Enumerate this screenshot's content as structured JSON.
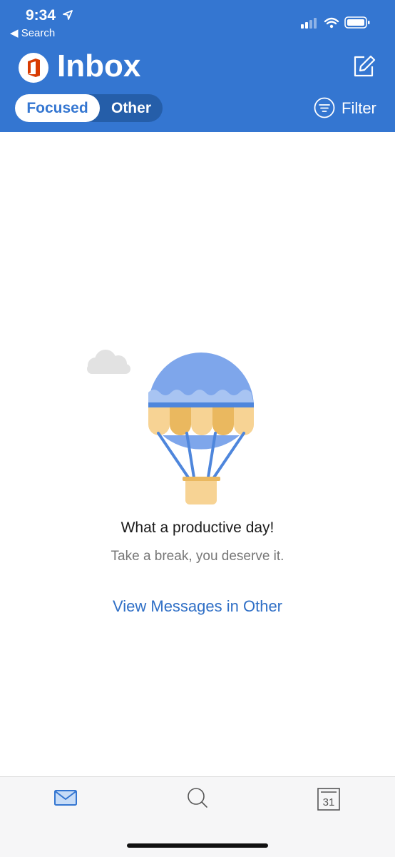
{
  "status_bar": {
    "time": "9:34",
    "back_label": "◀ Search"
  },
  "header": {
    "title": "Inbox",
    "compose_icon": "compose-icon",
    "brand_color": "#3476D1"
  },
  "segments": {
    "focused": "Focused",
    "other": "Other",
    "selected": "Focused"
  },
  "filter": {
    "label": "Filter",
    "icon": "filter-icon"
  },
  "empty_state": {
    "illustration": "hot-air-balloon",
    "title": "What a productive day!",
    "subtitle": "Take a break, you deserve it.",
    "link": "View Messages in Other"
  },
  "tabbar": {
    "items": [
      {
        "name": "mail",
        "icon": "mail-icon",
        "active": true
      },
      {
        "name": "search",
        "icon": "search-icon",
        "active": false
      },
      {
        "name": "calendar",
        "icon": "calendar-icon",
        "date": "31",
        "active": false
      }
    ]
  }
}
